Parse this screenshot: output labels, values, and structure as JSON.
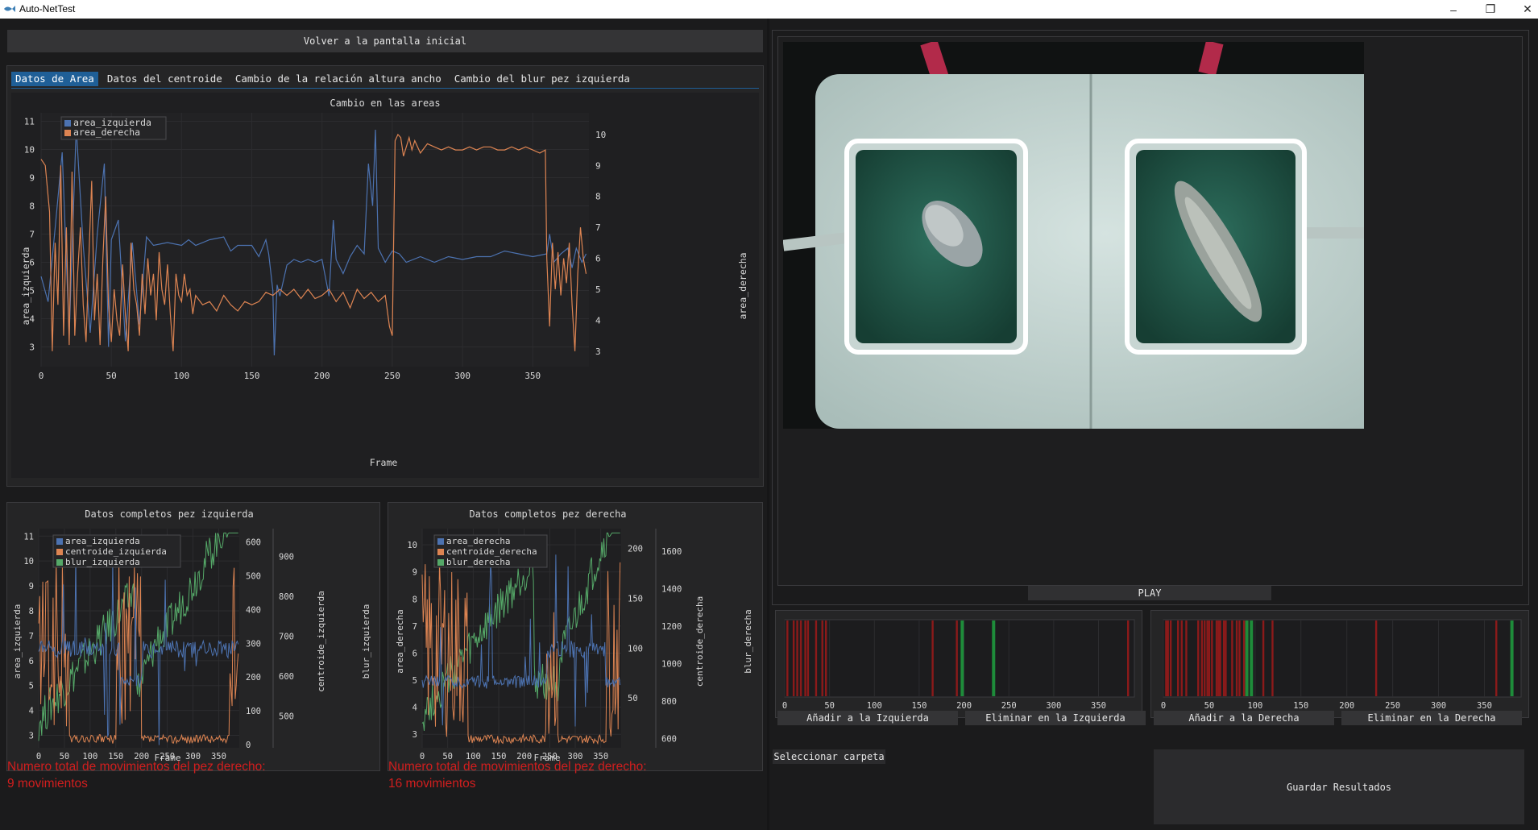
{
  "window": {
    "title": "Auto-NetTest"
  },
  "top_button": "Volver a la pantalla inicial",
  "tabs": [
    {
      "label": "Datos de Area"
    },
    {
      "label": "Datos del centroide"
    },
    {
      "label": "Cambio de la relación altura ancho"
    },
    {
      "label": "Cambio del blur pez izquierda"
    }
  ],
  "main_plot": {
    "title": "Cambio en las areas",
    "xlabel": "Frame",
    "ylabel_left": "area_izquierda",
    "ylabel_right": "area_derecha",
    "legend": [
      "area_izquierda",
      "area_derecha"
    ]
  },
  "left_plot": {
    "title": "Datos completos pez izquierda",
    "xlabel": "Frame",
    "ylabels": [
      "area_izquierda",
      "centroide_izquierda",
      "blur_izquierda"
    ],
    "legend": [
      "area_izquierda",
      "centroide_izquierda",
      "blur_izquierda"
    ]
  },
  "right_plot": {
    "title": "Datos completos pez derecha",
    "xlabel": "Frame",
    "ylabels": [
      "area_derecha",
      "centroide_derecha",
      "blur_derecha"
    ],
    "legend": [
      "area_derecha",
      "centroide_derecha",
      "blur_derecha"
    ]
  },
  "movements": {
    "left_line1": "Numero total de movimientos del pez derecho:",
    "left_line2": "9 movimientos",
    "right_line1": "Numero total de movimientos del pez derecho:",
    "right_line2": "16 movimientos"
  },
  "play_button": "PLAY",
  "buttons": {
    "add_left": "Añadir a la Izquierda",
    "remove_left": "Eliminar en la Izquierda",
    "add_right": "Añadir a la Derecha",
    "remove_right": "Eliminar en la Derecha",
    "select_folder": "Seleccionar carpeta",
    "save_results": "Guardar Resultados"
  },
  "colors": {
    "blue": "#4c72b0",
    "orange": "#dd8452",
    "green": "#55a868",
    "red_marker": "#8b1a1a",
    "green_marker": "#1e8c3a",
    "tab_active": "#1f5f97",
    "alert_text": "#d21e1e"
  },
  "chart_data": [
    {
      "type": "line",
      "title": "Cambio en las areas",
      "xlabel": "Frame",
      "xlim": [
        0,
        390
      ],
      "x_ticks": [
        0,
        50,
        100,
        150,
        200,
        250,
        300,
        350
      ],
      "left_axis": {
        "label": "area_izquierda",
        "ticks": [
          3,
          4,
          5,
          6,
          7,
          8,
          9,
          10,
          11
        ],
        "ylim": [
          2.3,
          11.3
        ]
      },
      "right_axis": {
        "label": "area_derecha",
        "ticks": [
          3,
          4,
          5,
          6,
          7,
          8,
          9,
          10
        ],
        "ylim": [
          2.5,
          10.7
        ]
      },
      "series": [
        {
          "name": "area_izquierda",
          "axis": "left",
          "points": [
            [
              0,
              5.5
            ],
            [
              5,
              4.6
            ],
            [
              10,
              7.2
            ],
            [
              15,
              9.9
            ],
            [
              20,
              3.4
            ],
            [
              25,
              10.8
            ],
            [
              30,
              6.6
            ],
            [
              35,
              3.5
            ],
            [
              40,
              7.0
            ],
            [
              45,
              9.5
            ],
            [
              48,
              3.0
            ],
            [
              50,
              6.8
            ],
            [
              55,
              7.5
            ],
            [
              60,
              3.2
            ],
            [
              65,
              6.7
            ],
            [
              70,
              3.8
            ],
            [
              75,
              6.9
            ],
            [
              80,
              6.6
            ],
            [
              90,
              6.7
            ],
            [
              100,
              6.6
            ],
            [
              105,
              6.8
            ],
            [
              110,
              6.6
            ],
            [
              120,
              6.8
            ],
            [
              130,
              6.9
            ],
            [
              135,
              6.4
            ],
            [
              140,
              6.6
            ],
            [
              150,
              6.6
            ],
            [
              155,
              6.2
            ],
            [
              160,
              6.8
            ],
            [
              162,
              6.3
            ],
            [
              165,
              5.0
            ],
            [
              166,
              2.7
            ],
            [
              168,
              5.2
            ],
            [
              170,
              4.8
            ],
            [
              175,
              5.9
            ],
            [
              180,
              6.1
            ],
            [
              185,
              6.0
            ],
            [
              190,
              6.1
            ],
            [
              195,
              6.0
            ],
            [
              200,
              6.1
            ],
            [
              205,
              4.8
            ],
            [
              208,
              7.5
            ],
            [
              210,
              6.1
            ],
            [
              215,
              5.6
            ],
            [
              220,
              6.2
            ],
            [
              225,
              6.6
            ],
            [
              230,
              6.3
            ],
            [
              233,
              9.5
            ],
            [
              236,
              8.0
            ],
            [
              238,
              10.7
            ],
            [
              240,
              6.5
            ],
            [
              245,
              6.0
            ],
            [
              250,
              6.4
            ],
            [
              255,
              6.3
            ],
            [
              260,
              6.0
            ],
            [
              270,
              6.2
            ],
            [
              280,
              6.0
            ],
            [
              290,
              6.2
            ],
            [
              300,
              6.1
            ],
            [
              310,
              6.2
            ],
            [
              320,
              6.2
            ],
            [
              330,
              6.4
            ],
            [
              340,
              6.3
            ],
            [
              350,
              6.2
            ],
            [
              360,
              6.3
            ],
            [
              362,
              7.0
            ],
            [
              365,
              6.0
            ],
            [
              370,
              6.3
            ],
            [
              375,
              6.5
            ],
            [
              378,
              5.8
            ],
            [
              381,
              6.5
            ],
            [
              385,
              6.0
            ],
            [
              388,
              6.3
            ]
          ]
        },
        {
          "name": "area_derecha",
          "axis": "right",
          "points": [
            [
              0,
              9.2
            ],
            [
              3,
              9.0
            ],
            [
              6,
              7.5
            ],
            [
              8,
              3.0
            ],
            [
              10,
              6.5
            ],
            [
              12,
              4.5
            ],
            [
              14,
              9.0
            ],
            [
              16,
              3.5
            ],
            [
              18,
              7.0
            ],
            [
              20,
              3.2
            ],
            [
              22,
              8.8
            ],
            [
              24,
              3.5
            ],
            [
              26,
              5.5
            ],
            [
              28,
              7.0
            ],
            [
              30,
              4.5
            ],
            [
              32,
              3.3
            ],
            [
              34,
              6.0
            ],
            [
              36,
              8.5
            ],
            [
              38,
              4.0
            ],
            [
              40,
              5.5
            ],
            [
              42,
              3.2
            ],
            [
              44,
              6.0
            ],
            [
              46,
              8.0
            ],
            [
              48,
              4.5
            ],
            [
              50,
              3.3
            ],
            [
              52,
              5.0
            ],
            [
              54,
              4.0
            ],
            [
              56,
              3.5
            ],
            [
              58,
              5.8
            ],
            [
              60,
              4.2
            ],
            [
              62,
              3.0
            ],
            [
              64,
              6.5
            ],
            [
              66,
              5.0
            ],
            [
              68,
              4.5
            ],
            [
              70,
              3.5
            ],
            [
              72,
              5.5
            ],
            [
              74,
              4.2
            ],
            [
              76,
              6.0
            ],
            [
              78,
              4.8
            ],
            [
              80,
              5.5
            ],
            [
              82,
              4.0
            ],
            [
              84,
              6.2
            ],
            [
              86,
              5.0
            ],
            [
              88,
              4.5
            ],
            [
              90,
              5.8
            ],
            [
              92,
              4.2
            ],
            [
              94,
              3.0
            ],
            [
              96,
              5.5
            ],
            [
              98,
              4.8
            ],
            [
              100,
              4.6
            ],
            [
              102,
              5.5
            ],
            [
              104,
              4.8
            ],
            [
              106,
              5.0
            ],
            [
              108,
              4.2
            ],
            [
              110,
              4.8
            ],
            [
              115,
              4.5
            ],
            [
              120,
              4.6
            ],
            [
              125,
              4.3
            ],
            [
              130,
              4.8
            ],
            [
              135,
              4.5
            ],
            [
              140,
              4.3
            ],
            [
              145,
              4.6
            ],
            [
              150,
              4.5
            ],
            [
              155,
              4.6
            ],
            [
              160,
              4.9
            ],
            [
              165,
              4.8
            ],
            [
              170,
              5.0
            ],
            [
              175,
              4.8
            ],
            [
              180,
              5.0
            ],
            [
              185,
              4.7
            ],
            [
              190,
              5.0
            ],
            [
              195,
              4.7
            ],
            [
              200,
              4.8
            ],
            [
              205,
              5.0
            ],
            [
              210,
              4.6
            ],
            [
              215,
              4.9
            ],
            [
              220,
              4.4
            ],
            [
              225,
              5.0
            ],
            [
              230,
              4.7
            ],
            [
              235,
              4.9
            ],
            [
              240,
              4.6
            ],
            [
              245,
              4.8
            ],
            [
              248,
              3.8
            ],
            [
              250,
              3.5
            ],
            [
              252,
              9.8
            ],
            [
              254,
              10.0
            ],
            [
              256,
              9.9
            ],
            [
              258,
              9.3
            ],
            [
              260,
              9.6
            ],
            [
              262,
              9.9
            ],
            [
              264,
              9.5
            ],
            [
              266,
              9.8
            ],
            [
              270,
              9.4
            ],
            [
              275,
              9.7
            ],
            [
              280,
              9.6
            ],
            [
              285,
              9.5
            ],
            [
              290,
              9.6
            ],
            [
              295,
              9.5
            ],
            [
              300,
              9.5
            ],
            [
              305,
              9.6
            ],
            [
              310,
              9.5
            ],
            [
              315,
              9.6
            ],
            [
              320,
              9.6
            ],
            [
              325,
              9.5
            ],
            [
              330,
              9.5
            ],
            [
              335,
              9.6
            ],
            [
              340,
              9.5
            ],
            [
              345,
              9.6
            ],
            [
              350,
              9.5
            ],
            [
              355,
              9.4
            ],
            [
              359,
              9.5
            ],
            [
              360,
              6.0
            ],
            [
              362,
              3.8
            ],
            [
              364,
              6.5
            ],
            [
              366,
              5.0
            ],
            [
              368,
              6.2
            ],
            [
              370,
              4.8
            ],
            [
              372,
              6.0
            ],
            [
              374,
              5.2
            ],
            [
              376,
              6.5
            ],
            [
              378,
              4.5
            ],
            [
              380,
              3.0
            ],
            [
              382,
              5.5
            ],
            [
              384,
              7.0
            ],
            [
              386,
              6.0
            ],
            [
              388,
              5.5
            ]
          ]
        }
      ]
    },
    {
      "type": "line",
      "title": "Datos completos pez izquierda",
      "xlabel": "Frame",
      "x_ticks": [
        0,
        50,
        100,
        150,
        200,
        250,
        300,
        350
      ],
      "xlim": [
        0,
        390
      ],
      "axes": [
        {
          "label": "area_izquierda",
          "ticks": [
            3,
            4,
            5,
            6,
            7,
            8,
            9,
            10,
            11
          ],
          "ylim": [
            2.5,
            11.3
          ]
        },
        {
          "label": "centroide_izquierda",
          "ticks": [
            0,
            100,
            200,
            300,
            400,
            500,
            600
          ],
          "ylim": [
            -10,
            640
          ]
        },
        {
          "label": "blur_izquierda",
          "ticks": [
            500,
            600,
            700,
            800,
            900
          ],
          "ylim": [
            420,
            970
          ]
        }
      ],
      "series_names": [
        "area_izquierda",
        "centroide_izquierda",
        "blur_izquierda"
      ]
    },
    {
      "type": "line",
      "title": "Datos completos pez derecha",
      "xlabel": "Frame",
      "x_ticks": [
        0,
        50,
        100,
        150,
        200,
        250,
        300,
        350
      ],
      "xlim": [
        0,
        390
      ],
      "axes": [
        {
          "label": "area_derecha",
          "ticks": [
            3,
            4,
            5,
            6,
            7,
            8,
            9,
            10
          ],
          "ylim": [
            2.5,
            10.6
          ]
        },
        {
          "label": "centroide_derecha",
          "ticks": [
            50,
            100,
            150,
            200
          ],
          "ylim": [
            0,
            220
          ]
        },
        {
          "label": "blur_derecha",
          "ticks": [
            600,
            800,
            1000,
            1200,
            1400,
            1600
          ],
          "ylim": [
            550,
            1720
          ]
        }
      ],
      "series_names": [
        "area_derecha",
        "centroide_derecha",
        "blur_derecha"
      ]
    },
    {
      "type": "bar",
      "title": "",
      "x_ticks": [
        0,
        50,
        100,
        150,
        200,
        250,
        300,
        350
      ],
      "xlim": [
        0,
        390
      ],
      "red_markers": [
        3,
        10,
        14,
        18,
        23,
        26,
        35,
        42,
        46,
        165,
        192,
        383
      ],
      "green_markers": [
        198,
        233
      ]
    },
    {
      "type": "bar",
      "title": "",
      "x_ticks": [
        0,
        50,
        100,
        150,
        200,
        250,
        300,
        350
      ],
      "xlim": [
        0,
        390
      ],
      "red_markers": [
        3,
        5,
        8,
        16,
        20,
        25,
        38,
        42,
        45,
        48,
        50,
        53,
        58,
        60,
        62,
        66,
        68,
        75,
        80,
        83,
        88,
        109,
        119,
        232,
        363
      ],
      "green_markers": [
        91,
        96,
        380
      ]
    }
  ]
}
